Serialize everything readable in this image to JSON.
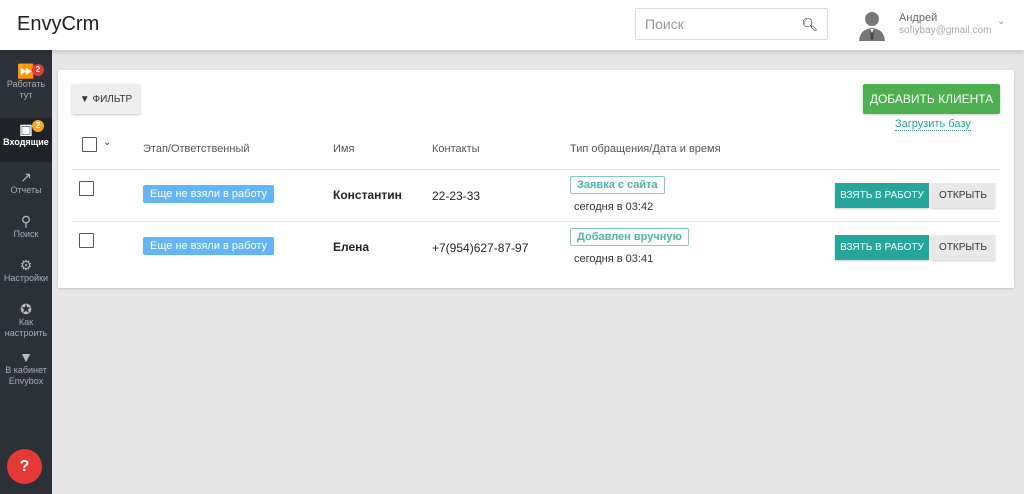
{
  "header": {
    "logo": "EnvyCrm",
    "search_placeholder": "Поиск",
    "user_name": "Андрей",
    "user_email": "sofiybay@gmail.com"
  },
  "sidebar": {
    "items": [
      {
        "label": "Работать тут",
        "icon": "fast-forward-icon",
        "badge": "2",
        "badge_color": "#e53935"
      },
      {
        "label": "Входящие",
        "icon": "inbox-user-icon",
        "badge": "2",
        "badge_color": "#f5a623",
        "active": true
      },
      {
        "label": "Отчеты",
        "icon": "trending-up-icon"
      },
      {
        "label": "Поиск",
        "icon": "search-icon"
      },
      {
        "label": "Настройки",
        "icon": "gear-icon"
      },
      {
        "label": "Как настроить",
        "icon": "compass-icon"
      },
      {
        "label": "В кабинет Envybox",
        "icon": "envybox-icon"
      }
    ],
    "help": "?"
  },
  "toolbar": {
    "filter": "ФИЛЬТР",
    "add_client": "ДОБАВИТЬ КЛИЕНТА",
    "upload": "Загрузить базу"
  },
  "table": {
    "columns": [
      "Этап/Ответственный",
      "Имя",
      "Контакты",
      "Тип обращения/Дата и время"
    ],
    "rows": [
      {
        "stage": "Еще не взяли в работу",
        "name": "Константин",
        "contact": "22-23-33",
        "source": "Заявка с сайта",
        "time": "сегодня в 03:42",
        "take": "ВЗЯТЬ В РАБОТУ",
        "open": "ОТКРЫТЬ"
      },
      {
        "stage": "Еще не взяли в работу",
        "name": "Елена",
        "contact": "+7(954)627-87-97",
        "source": "Добавлен вручную",
        "time": "сегодня в 03:41",
        "take": "ВЗЯТЬ В РАБОТУ",
        "open": "ОТКРЫТЬ"
      }
    ]
  }
}
